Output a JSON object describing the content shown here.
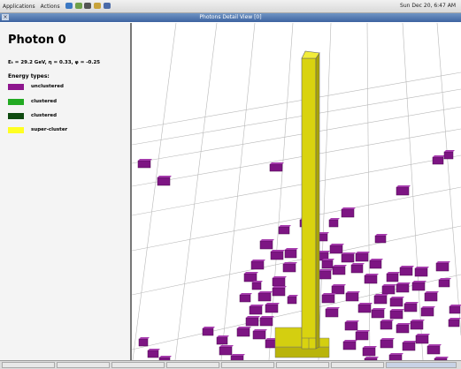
{
  "topbar": {
    "applications": "Applications",
    "actions": "Actions",
    "clock": "Sun Dec 20,  6:47 AM"
  },
  "window": {
    "title": "Photons Detail View [0]"
  },
  "panel": {
    "title": "Photon 0",
    "params": "Eₜ = 29.2 GeV, η = 0.33, φ = -0.25",
    "energy_types_label": "Energy types:",
    "legend": [
      {
        "label": "unclustered",
        "color": "#8e168e"
      },
      {
        "label": "clustered",
        "color": "#22aa22"
      },
      {
        "label": "clustered",
        "color": "#0f4a10"
      },
      {
        "label": "super-cluster",
        "color": "#ffff22"
      }
    ]
  },
  "colors": {
    "tower_purple": "#7d1583",
    "tower_yellow": "#d4cf10",
    "grid": "#b8b8b8"
  }
}
